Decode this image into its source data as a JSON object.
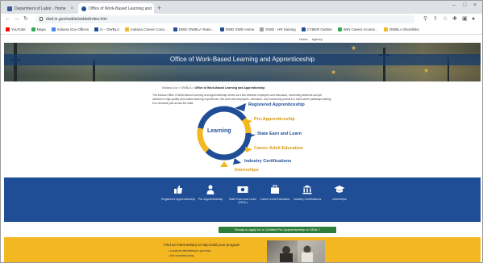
{
  "browser": {
    "tabs": [
      {
        "label": "Department of Labor · Home",
        "active": false,
        "color": "#3b5998"
      },
      {
        "label": "Office of Work-Based Learning and",
        "active": true,
        "color": "#1f4e97"
      }
    ],
    "new_tab": "+",
    "url": "dwd.in.gov/owbla/owbla/index.htm",
    "bookmarks": [
      {
        "label": "YouTube",
        "color": "#ff0000"
      },
      {
        "label": "Maps",
        "color": "#34a853"
      },
      {
        "label": "Indiana Gov Offices",
        "color": "#4285f4"
      },
      {
        "label": "In - OWBLA",
        "color": "#1f4e97"
      },
      {
        "label": "Indiana Career Conn...",
        "color": "#f3b721"
      },
      {
        "label": "DWD OWBLA Team...",
        "color": "#1f4e97"
      },
      {
        "label": "DWD SWD Home",
        "color": "#1f4e97"
      },
      {
        "label": "DWD - HR training",
        "color": "#9aa0a6"
      },
      {
        "label": "CYBER Outline",
        "color": "#1f4e97"
      },
      {
        "label": "WIN Career Access...",
        "color": "#34a853"
      },
      {
        "label": "OWBLA Shortlinks",
        "color": "#f3b721"
      }
    ]
  },
  "site": {
    "util_links": [
      "Home",
      "Agency"
    ],
    "hero_title": "Office of Work-Based Learning and Apprenticeship",
    "breadcrumb": [
      "Indiana.Gov",
      "OWBLA",
      "Office of Work-Based Learning and Apprenticeship"
    ],
    "intro": "The Indiana Office of Work-Based Learning and Apprenticeship serves as a link between employers and educators, connecting students and job seekers to high-quality work-based learning experiences. We work with employers, educators, and community partners to build career pathways leading to in-demand jobs across the state.",
    "diagram": {
      "center_label": "Learning",
      "items": [
        {
          "label": "Registered Apprenticeship",
          "color": "#1f4e97"
        },
        {
          "label": "Pre-Apprenticeship",
          "color": "#f3b721"
        },
        {
          "label": "State Earn and Learn",
          "color": "#1f4e97"
        },
        {
          "label": "Career Adult Education",
          "color": "#f3b721"
        },
        {
          "label": "Industry Certifications",
          "color": "#1f4e97"
        },
        {
          "label": "Internships",
          "color": "#f3b721"
        }
      ]
    },
    "pathways": [
      {
        "label": "Registered Apprenticeship",
        "icon": "thumbs-up-icon"
      },
      {
        "label": "Pre-Apprenticeship",
        "icon": "person-icon"
      },
      {
        "label": "State Earn and Learn (SEAL)",
        "icon": "money-icon"
      },
      {
        "label": "Career Adult Education",
        "icon": "briefcase-icon"
      },
      {
        "label": "Industry Certifications",
        "icon": "building-icon"
      },
      {
        "label": "Internships",
        "icon": "graduation-cap-icon"
      }
    ],
    "cta_label": "Ready to apply for a Certified Pre-Apprenticeship or SEAL?",
    "find_intermediary": "Find an intermediary to help build your program",
    "bullets": [
      "Locate an intermediary in your area",
      "Get connected today"
    ]
  },
  "colors": {
    "blue": "#1f4e97",
    "gold": "#f3b721",
    "green": "#2f7d3a"
  }
}
